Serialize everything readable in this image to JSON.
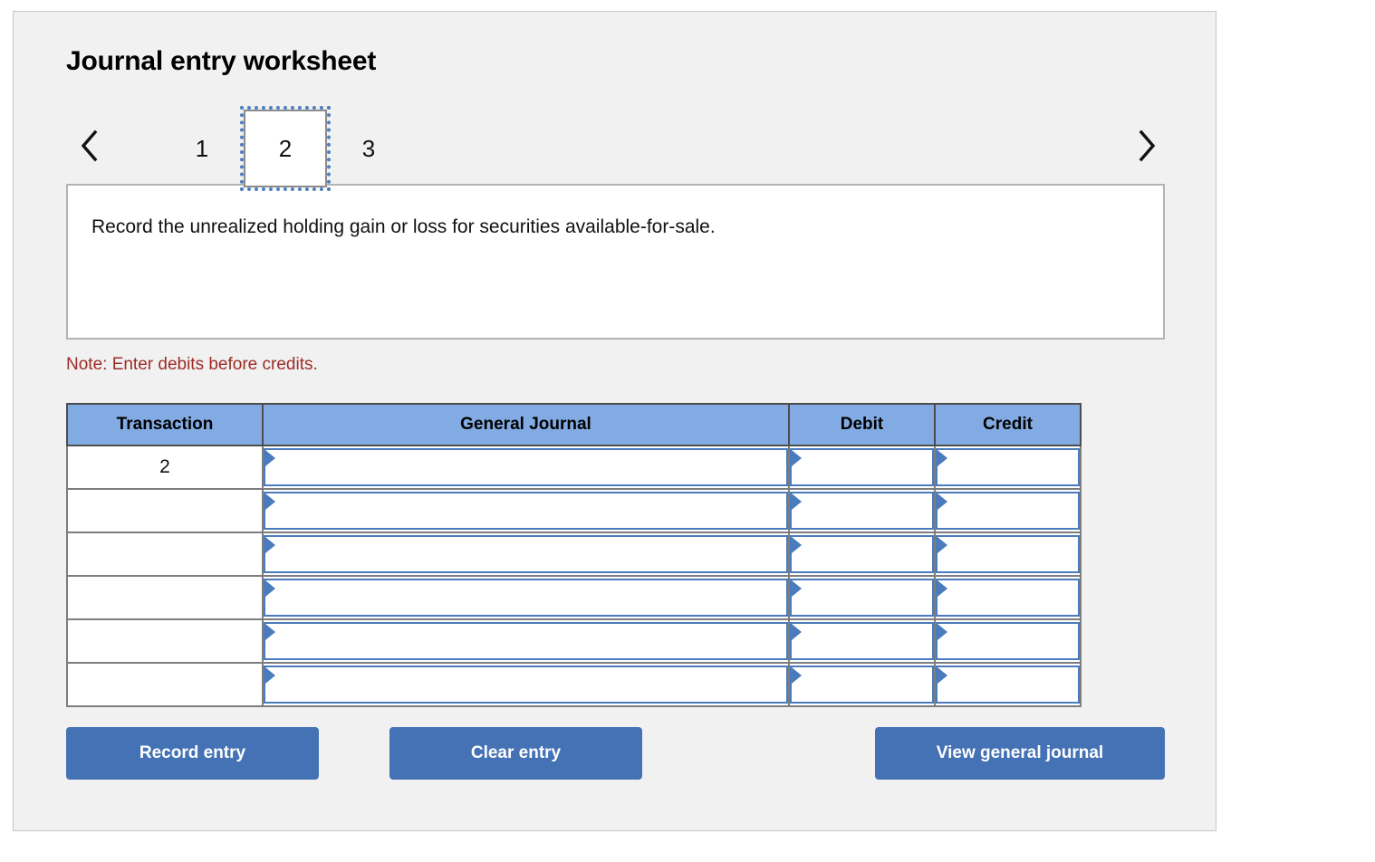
{
  "worksheet": {
    "title": "Journal entry worksheet",
    "pager": {
      "prev_icon": "chevron-left-icon",
      "next_icon": "chevron-right-icon",
      "tabs": [
        {
          "label": "1",
          "selected": false
        },
        {
          "label": "2",
          "selected": true
        },
        {
          "label": "3",
          "selected": false
        }
      ]
    },
    "instruction": "Record the unrealized holding gain or loss for securities available-for-sale.",
    "note": "Note: Enter debits before credits.",
    "table": {
      "headers": {
        "transaction": "Transaction",
        "general_journal": "General Journal",
        "debit": "Debit",
        "credit": "Credit"
      },
      "rows": [
        {
          "transaction": "2",
          "general_journal": "",
          "debit": "",
          "credit": ""
        },
        {
          "transaction": "",
          "general_journal": "",
          "debit": "",
          "credit": ""
        },
        {
          "transaction": "",
          "general_journal": "",
          "debit": "",
          "credit": ""
        },
        {
          "transaction": "",
          "general_journal": "",
          "debit": "",
          "credit": ""
        },
        {
          "transaction": "",
          "general_journal": "",
          "debit": "",
          "credit": ""
        },
        {
          "transaction": "",
          "general_journal": "",
          "debit": "",
          "credit": ""
        }
      ]
    },
    "buttons": {
      "record_entry": "Record entry",
      "clear_entry": "Clear entry",
      "view_general_journal": "View general journal"
    },
    "colors": {
      "panel_background": "#f1f1f1",
      "table_header_blue": "#82abe3",
      "button_blue": "#4472b5",
      "input_border_blue": "#4a7cbd",
      "note_red": "#9c2b26"
    }
  }
}
